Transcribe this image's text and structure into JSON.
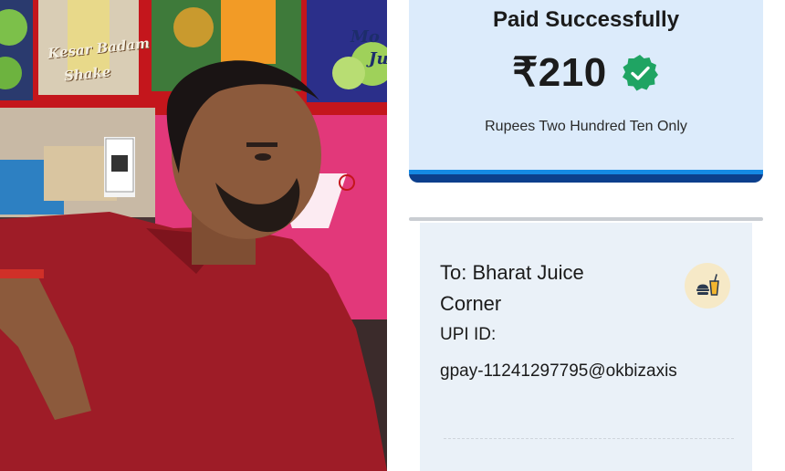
{
  "photo": {
    "sign_text_1": "Kesar Badam",
    "sign_text_2": "Shake",
    "sign_text_3": "Mo",
    "sign_text_4": "Ju"
  },
  "payment": {
    "status": "Paid Successfully",
    "amount": "₹210",
    "amount_words": "Rupees Two Hundred Ten Only",
    "to_label": "To: Bharat Juice Corner",
    "upi_label": "UPI ID:",
    "upi_id": "gpay-11241297795@okbizaxis",
    "colors": {
      "card_bg": "#dcebfb",
      "accent": "#1589e3",
      "verified_green": "#1fa463"
    },
    "icons": {
      "verified": "verified-check-icon",
      "category": "food-drink-icon"
    }
  }
}
